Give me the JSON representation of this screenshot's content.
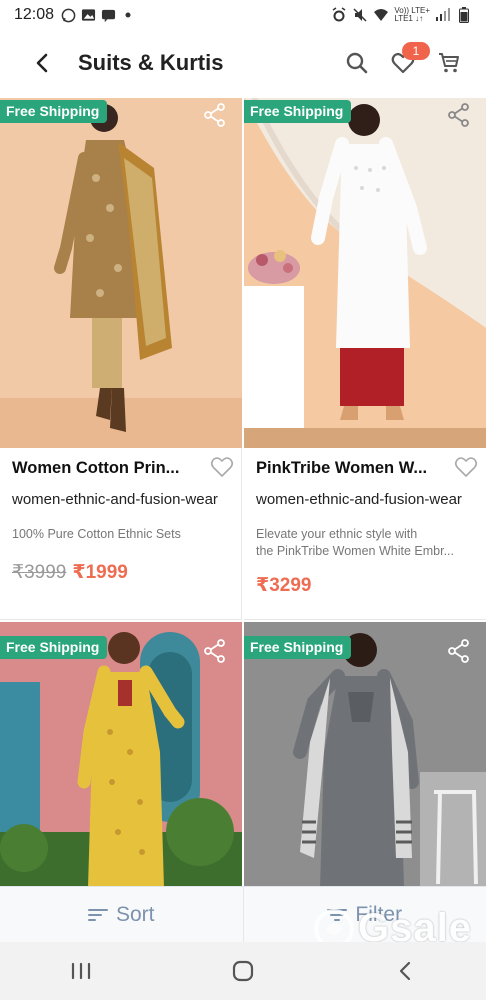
{
  "status_bar": {
    "time": "12:08",
    "network_top": "Vo)) LTE+",
    "network_bottom": "LTE1 ↓↑"
  },
  "app_bar": {
    "title": "Suits & Kurtis",
    "cart_badge": "1"
  },
  "products": [
    {
      "tag": "Free Shipping",
      "title": "Women Cotton Prin...",
      "category": "women-ethnic-and-fusion-wear",
      "description_line1": "100% Pure Cotton Ethnic Sets",
      "description_line2": "",
      "mrp": "₹3999",
      "price": "₹1999"
    },
    {
      "tag": "Free Shipping",
      "title": "PinkTribe Women W...",
      "category": "women-ethnic-and-fusion-wear",
      "description_line1": "Elevate your ethnic style with",
      "description_line2": "the PinkTribe Women White Embr...",
      "mrp": "",
      "price": "₹3299"
    },
    {
      "tag": "Free Shipping"
    },
    {
      "tag": "Free Shipping"
    }
  ],
  "bottom_bar": {
    "sort_label": "Sort",
    "filter_label": "Filter"
  },
  "watermark": "Gsale",
  "icons": {
    "back": "back-arrow-icon",
    "search": "search-icon",
    "wishlist": "heart-icon",
    "cart": "cart-icon",
    "share": "share-icon",
    "sort": "sort-icon",
    "filter": "filter-icon"
  },
  "colors": {
    "free_shipping": "#2aa57c",
    "price": "#ee6d52",
    "badge": "#f0644b",
    "bottom_bar_text": "#7d93ad"
  }
}
